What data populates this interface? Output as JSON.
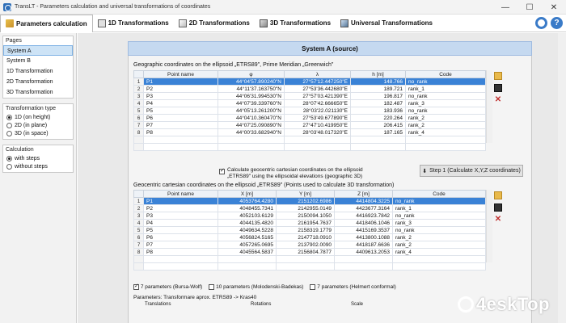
{
  "window": {
    "title": "TransLT - Parameters calculation and universal transformations of coordinates",
    "minimize": "—",
    "maximize": "☐",
    "close": "✕"
  },
  "tabs": [
    {
      "label": "Parameters calculation",
      "icon": "calculator-icon"
    },
    {
      "label": "1D Transformations",
      "icon": "cube-1d-icon"
    },
    {
      "label": "2D Transformations",
      "icon": "cube-2d-icon"
    },
    {
      "label": "3D Transformations",
      "icon": "cube-3d-icon"
    },
    {
      "label": "Universal Transformations",
      "icon": "universal-icon"
    }
  ],
  "sidebar": {
    "pages_title": "Pages",
    "pages": [
      "System A",
      "System B",
      "1D Transformation",
      "2D Transformation",
      "3D Transformation"
    ],
    "transformation_title": "Transformation type",
    "transformation_options": [
      "1D (on height)",
      "2D (in plane)",
      "3D (in space)"
    ],
    "calculation_title": "Calculation",
    "calculation_options": [
      "with steps",
      "without steps"
    ]
  },
  "main": {
    "section_title": "System A (source)",
    "geo_caption": "Geographic coordinates on the ellipsoid „ETRS89\", Prime Meridian „Greenwich\"",
    "geo_headers": [
      "Point name",
      "φ",
      "λ",
      "h [m]",
      "Code"
    ],
    "geo_rows": [
      [
        "1",
        "P1",
        "44°04'57.890240\"N",
        "27°57'12.447250\"E",
        "148.766",
        "no_rank"
      ],
      [
        "2",
        "P2",
        "44°11'37.163750\"N",
        "27°53'36.442680\"E",
        "189.721",
        "rank_1"
      ],
      [
        "3",
        "P3",
        "44°06'31.994530\"N",
        "27°57'03.421390\"E",
        "196.817",
        "no_rank"
      ],
      [
        "4",
        "P4",
        "44°07'39.339760\"N",
        "28°07'42.666650\"E",
        "182.487",
        "rank_3"
      ],
      [
        "5",
        "P5",
        "44°05'13.261200\"N",
        "28°03'22.021130\"E",
        "183.936",
        "no_rank"
      ],
      [
        "6",
        "P6",
        "44°04'10.360470\"N",
        "27°53'49.677890\"E",
        "220.264",
        "rank_2"
      ],
      [
        "7",
        "P7",
        "44°07'25.090890\"N",
        "27°47'10.419950\"E",
        "206.415",
        "rank_2"
      ],
      [
        "8",
        "P8",
        "44°00'33.682940\"N",
        "28°03'48.017320\"E",
        "187.165",
        "rank_4"
      ]
    ],
    "calc_checkbox_label_1": "Calculate geocentric cartesian coordinates on the ellipsoid",
    "calc_checkbox_label_2": "„ETRS89\" using the ellipsoidal elevations (geographic 3D)",
    "step_button": "Step 1 (Calculate X,Y,Z coordinates)",
    "cart_caption": "Geocentric cartesian coordinates on the ellipsoid „ETRS89\" (Points used to calculate 3D transformation)",
    "cart_headers": [
      "Point name",
      "X [m]",
      "Y [m]",
      "Z [m]",
      "Code"
    ],
    "cart_rows": [
      [
        "1",
        "P1",
        "4053764.4280",
        "2151202.6986",
        "4414804.3225",
        "no_rank"
      ],
      [
        "2",
        "P2",
        "4048455.7341",
        "2142955.0149",
        "4423677.3164",
        "rank_1"
      ],
      [
        "3",
        "P3",
        "4052103.6129",
        "2150094.1050",
        "4416923.7842",
        "no_rank"
      ],
      [
        "4",
        "P4",
        "4044135.4820",
        "2161954.7637",
        "4418406.1046",
        "rank_3"
      ],
      [
        "5",
        "P5",
        "4049634.5228",
        "2158319.1779",
        "4415169.3537",
        "no_rank"
      ],
      [
        "6",
        "P6",
        "4056824.5165",
        "2147718.0910",
        "4413800.1088",
        "rank_2"
      ],
      [
        "7",
        "P7",
        "4057265.0695",
        "2137902.0090",
        "4418187.6636",
        "rank_2"
      ],
      [
        "8",
        "P8",
        "4045564.5837",
        "2156804.7877",
        "4409613.2053",
        "rank_4"
      ]
    ],
    "param_options": [
      {
        "label": "7 parameters (Bursa-Wolf)",
        "checked": true
      },
      {
        "label": "10 parameters (Molodenski-Badekas)",
        "checked": false
      },
      {
        "label": "7 parameters (Helmert conformal)",
        "checked": false
      }
    ],
    "params_caption": "Parameters: Transformare aprox. ETRS89 -> Kras40",
    "params_labels": [
      "Translations",
      "Rotations",
      "Scale"
    ]
  },
  "watermark": "4eskTop"
}
